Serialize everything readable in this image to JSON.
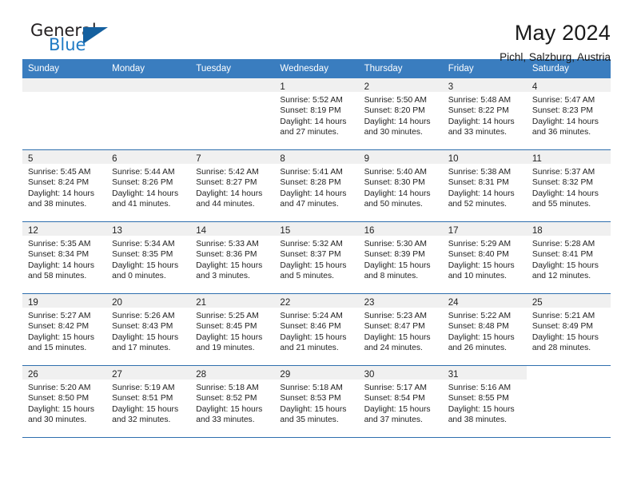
{
  "logo": {
    "word_one": "General",
    "word_two": "Blue",
    "triangle_color": "#15609f",
    "blue_color": "#1f7ac4"
  },
  "header": {
    "title": "May 2024",
    "subtitle": "Pichl, Salzburg, Austria"
  },
  "theme": {
    "header_blue": "#3a7dbf",
    "row_divider": "#2f6fae",
    "daynum_band": "#f0f0f0"
  },
  "weekday_headers": [
    "Sunday",
    "Monday",
    "Tuesday",
    "Wednesday",
    "Thursday",
    "Friday",
    "Saturday"
  ],
  "weeks": [
    [
      {
        "day": "",
        "state": "empty",
        "sunrise": "",
        "sunset": "",
        "daylight_1": "",
        "daylight_2": ""
      },
      {
        "day": "",
        "state": "empty",
        "sunrise": "",
        "sunset": "",
        "daylight_1": "",
        "daylight_2": ""
      },
      {
        "day": "",
        "state": "empty",
        "sunrise": "",
        "sunset": "",
        "daylight_1": "",
        "daylight_2": ""
      },
      {
        "day": "1",
        "state": "filled",
        "sunrise": "Sunrise: 5:52 AM",
        "sunset": "Sunset: 8:19 PM",
        "daylight_1": "Daylight: 14 hours",
        "daylight_2": "and 27 minutes."
      },
      {
        "day": "2",
        "state": "filled",
        "sunrise": "Sunrise: 5:50 AM",
        "sunset": "Sunset: 8:20 PM",
        "daylight_1": "Daylight: 14 hours",
        "daylight_2": "and 30 minutes."
      },
      {
        "day": "3",
        "state": "filled",
        "sunrise": "Sunrise: 5:48 AM",
        "sunset": "Sunset: 8:22 PM",
        "daylight_1": "Daylight: 14 hours",
        "daylight_2": "and 33 minutes."
      },
      {
        "day": "4",
        "state": "filled",
        "sunrise": "Sunrise: 5:47 AM",
        "sunset": "Sunset: 8:23 PM",
        "daylight_1": "Daylight: 14 hours",
        "daylight_2": "and 36 minutes."
      }
    ],
    [
      {
        "day": "5",
        "state": "filled",
        "sunrise": "Sunrise: 5:45 AM",
        "sunset": "Sunset: 8:24 PM",
        "daylight_1": "Daylight: 14 hours",
        "daylight_2": "and 38 minutes."
      },
      {
        "day": "6",
        "state": "filled",
        "sunrise": "Sunrise: 5:44 AM",
        "sunset": "Sunset: 8:26 PM",
        "daylight_1": "Daylight: 14 hours",
        "daylight_2": "and 41 minutes."
      },
      {
        "day": "7",
        "state": "filled",
        "sunrise": "Sunrise: 5:42 AM",
        "sunset": "Sunset: 8:27 PM",
        "daylight_1": "Daylight: 14 hours",
        "daylight_2": "and 44 minutes."
      },
      {
        "day": "8",
        "state": "filled",
        "sunrise": "Sunrise: 5:41 AM",
        "sunset": "Sunset: 8:28 PM",
        "daylight_1": "Daylight: 14 hours",
        "daylight_2": "and 47 minutes."
      },
      {
        "day": "9",
        "state": "filled",
        "sunrise": "Sunrise: 5:40 AM",
        "sunset": "Sunset: 8:30 PM",
        "daylight_1": "Daylight: 14 hours",
        "daylight_2": "and 50 minutes."
      },
      {
        "day": "10",
        "state": "filled",
        "sunrise": "Sunrise: 5:38 AM",
        "sunset": "Sunset: 8:31 PM",
        "daylight_1": "Daylight: 14 hours",
        "daylight_2": "and 52 minutes."
      },
      {
        "day": "11",
        "state": "filled",
        "sunrise": "Sunrise: 5:37 AM",
        "sunset": "Sunset: 8:32 PM",
        "daylight_1": "Daylight: 14 hours",
        "daylight_2": "and 55 minutes."
      }
    ],
    [
      {
        "day": "12",
        "state": "filled",
        "sunrise": "Sunrise: 5:35 AM",
        "sunset": "Sunset: 8:34 PM",
        "daylight_1": "Daylight: 14 hours",
        "daylight_2": "and 58 minutes."
      },
      {
        "day": "13",
        "state": "filled",
        "sunrise": "Sunrise: 5:34 AM",
        "sunset": "Sunset: 8:35 PM",
        "daylight_1": "Daylight: 15 hours",
        "daylight_2": "and 0 minutes."
      },
      {
        "day": "14",
        "state": "filled",
        "sunrise": "Sunrise: 5:33 AM",
        "sunset": "Sunset: 8:36 PM",
        "daylight_1": "Daylight: 15 hours",
        "daylight_2": "and 3 minutes."
      },
      {
        "day": "15",
        "state": "filled",
        "sunrise": "Sunrise: 5:32 AM",
        "sunset": "Sunset: 8:37 PM",
        "daylight_1": "Daylight: 15 hours",
        "daylight_2": "and 5 minutes."
      },
      {
        "day": "16",
        "state": "filled",
        "sunrise": "Sunrise: 5:30 AM",
        "sunset": "Sunset: 8:39 PM",
        "daylight_1": "Daylight: 15 hours",
        "daylight_2": "and 8 minutes."
      },
      {
        "day": "17",
        "state": "filled",
        "sunrise": "Sunrise: 5:29 AM",
        "sunset": "Sunset: 8:40 PM",
        "daylight_1": "Daylight: 15 hours",
        "daylight_2": "and 10 minutes."
      },
      {
        "day": "18",
        "state": "filled",
        "sunrise": "Sunrise: 5:28 AM",
        "sunset": "Sunset: 8:41 PM",
        "daylight_1": "Daylight: 15 hours",
        "daylight_2": "and 12 minutes."
      }
    ],
    [
      {
        "day": "19",
        "state": "filled",
        "sunrise": "Sunrise: 5:27 AM",
        "sunset": "Sunset: 8:42 PM",
        "daylight_1": "Daylight: 15 hours",
        "daylight_2": "and 15 minutes."
      },
      {
        "day": "20",
        "state": "filled",
        "sunrise": "Sunrise: 5:26 AM",
        "sunset": "Sunset: 8:43 PM",
        "daylight_1": "Daylight: 15 hours",
        "daylight_2": "and 17 minutes."
      },
      {
        "day": "21",
        "state": "filled",
        "sunrise": "Sunrise: 5:25 AM",
        "sunset": "Sunset: 8:45 PM",
        "daylight_1": "Daylight: 15 hours",
        "daylight_2": "and 19 minutes."
      },
      {
        "day": "22",
        "state": "filled",
        "sunrise": "Sunrise: 5:24 AM",
        "sunset": "Sunset: 8:46 PM",
        "daylight_1": "Daylight: 15 hours",
        "daylight_2": "and 21 minutes."
      },
      {
        "day": "23",
        "state": "filled",
        "sunrise": "Sunrise: 5:23 AM",
        "sunset": "Sunset: 8:47 PM",
        "daylight_1": "Daylight: 15 hours",
        "daylight_2": "and 24 minutes."
      },
      {
        "day": "24",
        "state": "filled",
        "sunrise": "Sunrise: 5:22 AM",
        "sunset": "Sunset: 8:48 PM",
        "daylight_1": "Daylight: 15 hours",
        "daylight_2": "and 26 minutes."
      },
      {
        "day": "25",
        "state": "filled",
        "sunrise": "Sunrise: 5:21 AM",
        "sunset": "Sunset: 8:49 PM",
        "daylight_1": "Daylight: 15 hours",
        "daylight_2": "and 28 minutes."
      }
    ],
    [
      {
        "day": "26",
        "state": "filled",
        "sunrise": "Sunrise: 5:20 AM",
        "sunset": "Sunset: 8:50 PM",
        "daylight_1": "Daylight: 15 hours",
        "daylight_2": "and 30 minutes."
      },
      {
        "day": "27",
        "state": "filled",
        "sunrise": "Sunrise: 5:19 AM",
        "sunset": "Sunset: 8:51 PM",
        "daylight_1": "Daylight: 15 hours",
        "daylight_2": "and 32 minutes."
      },
      {
        "day": "28",
        "state": "filled",
        "sunrise": "Sunrise: 5:18 AM",
        "sunset": "Sunset: 8:52 PM",
        "daylight_1": "Daylight: 15 hours",
        "daylight_2": "and 33 minutes."
      },
      {
        "day": "29",
        "state": "filled",
        "sunrise": "Sunrise: 5:18 AM",
        "sunset": "Sunset: 8:53 PM",
        "daylight_1": "Daylight: 15 hours",
        "daylight_2": "and 35 minutes."
      },
      {
        "day": "30",
        "state": "filled",
        "sunrise": "Sunrise: 5:17 AM",
        "sunset": "Sunset: 8:54 PM",
        "daylight_1": "Daylight: 15 hours",
        "daylight_2": "and 37 minutes."
      },
      {
        "day": "31",
        "state": "filled",
        "sunrise": "Sunrise: 5:16 AM",
        "sunset": "Sunset: 8:55 PM",
        "daylight_1": "Daylight: 15 hours",
        "daylight_2": "and 38 minutes."
      },
      {
        "day": "",
        "state": "blank",
        "sunrise": "",
        "sunset": "",
        "daylight_1": "",
        "daylight_2": ""
      }
    ]
  ]
}
